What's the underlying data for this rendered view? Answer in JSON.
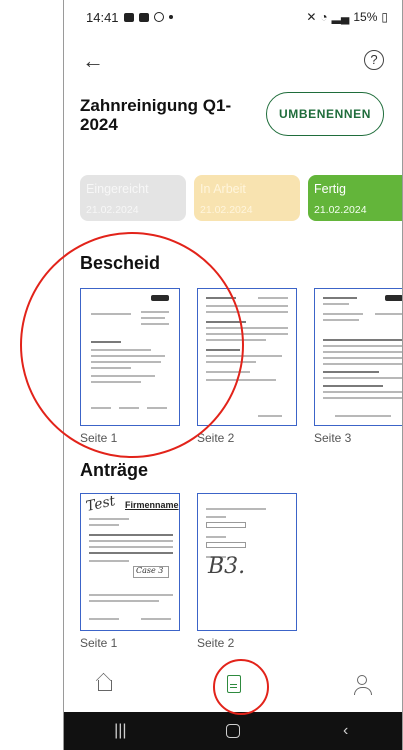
{
  "statusbar": {
    "time": "14:41",
    "battery": "15%"
  },
  "header": {
    "title": "Zahnreinigung Q1-2024",
    "rename_label": "UMBENENNEN"
  },
  "status_steps": [
    {
      "label": "Eingereicht",
      "date": "21.02.2024",
      "color": "#e4e4e4"
    },
    {
      "label": "In Arbeit",
      "date": "21.02.2024",
      "color": "#f8e3b0"
    },
    {
      "label": "Fertig",
      "date": "21.02.2024",
      "color": "#63b53a"
    }
  ],
  "bescheid": {
    "heading": "Bescheid",
    "pages": [
      {
        "label": "Seite 1"
      },
      {
        "label": "Seite 2"
      },
      {
        "label": "Seite 3"
      }
    ]
  },
  "antraege": {
    "heading": "Anträge",
    "pages": [
      {
        "label": "Seite 1"
      },
      {
        "label": "Seite 2"
      }
    ]
  },
  "page_texts": {
    "antrag1_handwriting": "Test",
    "antrag1_logo": "Firmenname",
    "antrag1_box": "Case 3",
    "antrag2_handwriting": "B3."
  },
  "bottom_nav": {
    "items": [
      "home-icon",
      "document-icon",
      "profile-icon"
    ],
    "active": "document-icon"
  },
  "accent_color": "#1f6d3b"
}
